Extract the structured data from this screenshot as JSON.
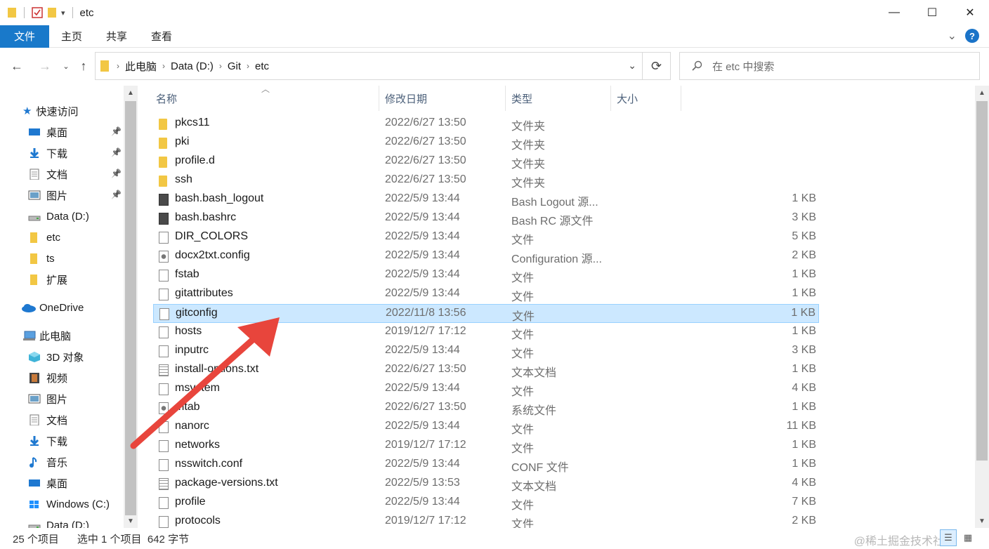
{
  "window": {
    "title": "etc",
    "minimize_glyph": "—",
    "maximize_glyph": "☐",
    "close_glyph": "✕"
  },
  "ribbon": {
    "tabs": [
      "文件",
      "主页",
      "共享",
      "查看"
    ],
    "help_glyph": "?",
    "collapse_glyph": "⌄"
  },
  "address": {
    "crumbs": [
      "此电脑",
      "Data (D:)",
      "Git",
      "etc"
    ],
    "search_placeholder": "在 etc 中搜索"
  },
  "nav": {
    "quick_access": "快速访问",
    "items": [
      {
        "label": "桌面",
        "icon": "desktop-icon",
        "pinned": true
      },
      {
        "label": "下载",
        "icon": "download-icon",
        "pinned": true
      },
      {
        "label": "文档",
        "icon": "documents-icon",
        "pinned": true
      },
      {
        "label": "图片",
        "icon": "pictures-icon",
        "pinned": true
      },
      {
        "label": "Data (D:)",
        "icon": "drive-icon",
        "pinned": false
      },
      {
        "label": "etc",
        "icon": "folder-icon",
        "pinned": false
      },
      {
        "label": "ts",
        "icon": "folder-icon",
        "pinned": false
      },
      {
        "label": "扩展",
        "icon": "folder-icon",
        "pinned": false
      }
    ],
    "onedrive": "OneDrive",
    "this_pc": "此电脑",
    "pc_items": [
      {
        "label": "3D 对象",
        "icon": "3d-objects-icon"
      },
      {
        "label": "视频",
        "icon": "videos-icon"
      },
      {
        "label": "图片",
        "icon": "pictures-icon"
      },
      {
        "label": "文档",
        "icon": "documents-icon"
      },
      {
        "label": "下载",
        "icon": "download-icon"
      },
      {
        "label": "音乐",
        "icon": "music-icon"
      },
      {
        "label": "桌面",
        "icon": "desktop-icon"
      },
      {
        "label": "Windows (C:)",
        "icon": "windows-drive-icon"
      },
      {
        "label": "Data (D:)",
        "icon": "drive-icon"
      }
    ]
  },
  "columns": {
    "name": "名称",
    "date": "修改日期",
    "type": "类型",
    "size": "大小"
  },
  "files": [
    {
      "name": "pkcs11",
      "date": "2022/6/27 13:50",
      "type": "文件夹",
      "size": "",
      "kind": "folder"
    },
    {
      "name": "pki",
      "date": "2022/6/27 13:50",
      "type": "文件夹",
      "size": "",
      "kind": "folder"
    },
    {
      "name": "profile.d",
      "date": "2022/6/27 13:50",
      "type": "文件夹",
      "size": "",
      "kind": "folder"
    },
    {
      "name": "ssh",
      "date": "2022/6/27 13:50",
      "type": "文件夹",
      "size": "",
      "kind": "folder"
    },
    {
      "name": "bash.bash_logout",
      "date": "2022/5/9 13:44",
      "type": "Bash Logout 源...",
      "size": "1 KB",
      "kind": "dark"
    },
    {
      "name": "bash.bashrc",
      "date": "2022/5/9 13:44",
      "type": "Bash RC 源文件",
      "size": "3 KB",
      "kind": "dark"
    },
    {
      "name": "DIR_COLORS",
      "date": "2022/5/9 13:44",
      "type": "文件",
      "size": "5 KB",
      "kind": "file"
    },
    {
      "name": "docx2txt.config",
      "date": "2022/5/9 13:44",
      "type": "Configuration 源...",
      "size": "2 KB",
      "kind": "cfg"
    },
    {
      "name": "fstab",
      "date": "2022/5/9 13:44",
      "type": "文件",
      "size": "1 KB",
      "kind": "file"
    },
    {
      "name": "gitattributes",
      "date": "2022/5/9 13:44",
      "type": "文件",
      "size": "1 KB",
      "kind": "file"
    },
    {
      "name": "gitconfig",
      "date": "2022/11/8 13:56",
      "type": "文件",
      "size": "1 KB",
      "kind": "file",
      "selected": true
    },
    {
      "name": "hosts",
      "date": "2019/12/7 17:12",
      "type": "文件",
      "size": "1 KB",
      "kind": "file"
    },
    {
      "name": "inputrc",
      "date": "2022/5/9 13:44",
      "type": "文件",
      "size": "3 KB",
      "kind": "file"
    },
    {
      "name": "install-options.txt",
      "date": "2022/6/27 13:50",
      "type": "文本文档",
      "size": "1 KB",
      "kind": "txt"
    },
    {
      "name": "msystem",
      "date": "2022/5/9 13:44",
      "type": "文件",
      "size": "4 KB",
      "kind": "file"
    },
    {
      "name": "mtab",
      "date": "2022/6/27 13:50",
      "type": "系统文件",
      "size": "1 KB",
      "kind": "cfg"
    },
    {
      "name": "nanorc",
      "date": "2022/5/9 13:44",
      "type": "文件",
      "size": "11 KB",
      "kind": "file"
    },
    {
      "name": "networks",
      "date": "2019/12/7 17:12",
      "type": "文件",
      "size": "1 KB",
      "kind": "file"
    },
    {
      "name": "nsswitch.conf",
      "date": "2022/5/9 13:44",
      "type": "CONF 文件",
      "size": "1 KB",
      "kind": "file"
    },
    {
      "name": "package-versions.txt",
      "date": "2022/5/9 13:53",
      "type": "文本文档",
      "size": "4 KB",
      "kind": "txt"
    },
    {
      "name": "profile",
      "date": "2022/5/9 13:44",
      "type": "文件",
      "size": "7 KB",
      "kind": "file"
    },
    {
      "name": "protocols",
      "date": "2019/12/7 17:12",
      "type": "文件",
      "size": "2 KB",
      "kind": "file"
    }
  ],
  "status": {
    "count": "25 个项目",
    "selection": "选中 1 个项目  642 字节"
  },
  "watermark": "@稀土掘金技术社区",
  "colors": {
    "accent": "#1979ca",
    "selection": "#cce8ff",
    "annotation_arrow": "#e8453c"
  }
}
